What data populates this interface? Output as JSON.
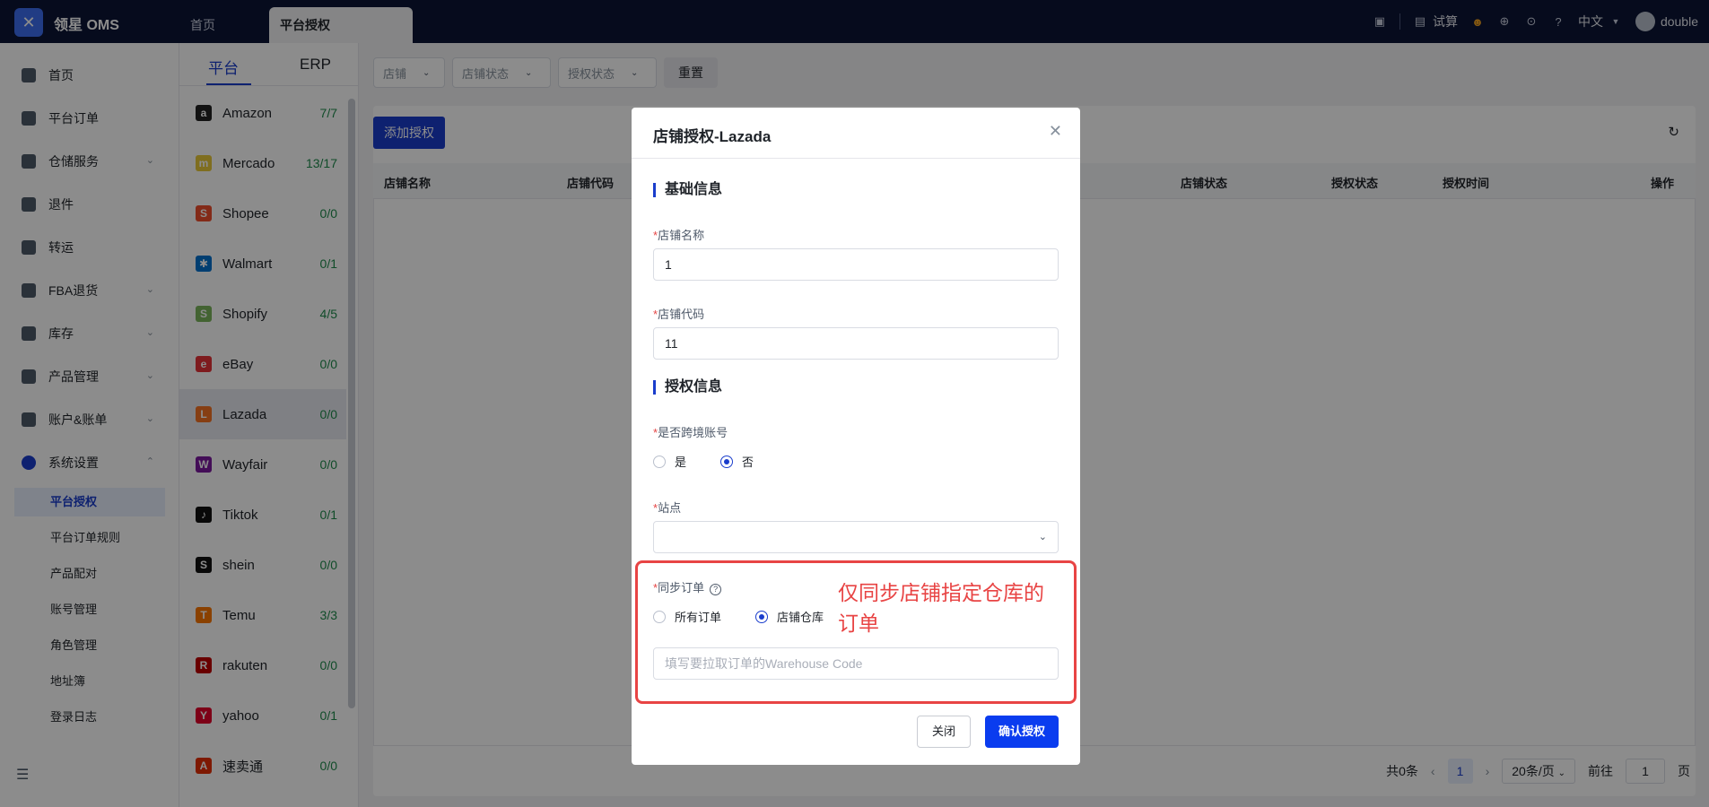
{
  "topbar": {
    "brand": "领星 OMS",
    "tabs": [
      {
        "label": "首页"
      },
      {
        "label": "平台授权"
      }
    ],
    "trial": "试算",
    "language": "中文",
    "user": "double"
  },
  "sidenav": {
    "items": [
      {
        "label": "首页",
        "icon": "home-icon"
      },
      {
        "label": "平台订单",
        "icon": "orders-icon"
      },
      {
        "label": "仓储服务",
        "icon": "warehouse-icon",
        "expandable": true
      },
      {
        "label": "退件",
        "icon": "return-icon"
      },
      {
        "label": "转运",
        "icon": "transfer-icon"
      },
      {
        "label": "FBA退货",
        "icon": "fba-icon",
        "expandable": true
      },
      {
        "label": "库存",
        "icon": "inventory-icon",
        "expandable": true
      },
      {
        "label": "产品管理",
        "icon": "product-icon",
        "expandable": true
      },
      {
        "label": "账户&账单",
        "icon": "account-icon",
        "expandable": true
      },
      {
        "label": "系统设置",
        "icon": "settings-icon",
        "expandable": true,
        "expanded": true
      }
    ],
    "subitems": [
      {
        "label": "平台授权",
        "active": true
      },
      {
        "label": "平台订单规则"
      },
      {
        "label": "产品配对"
      },
      {
        "label": "账号管理"
      },
      {
        "label": "角色管理"
      },
      {
        "label": "地址簿"
      },
      {
        "label": "登录日志"
      }
    ]
  },
  "platforms": {
    "tabs": [
      "平台",
      "ERP"
    ],
    "items": [
      {
        "name": "Amazon",
        "count": "7/7",
        "logo": "a",
        "color": "#222222"
      },
      {
        "name": "Mercado",
        "count": "13/17",
        "logo": "m",
        "color": "#e8c83a"
      },
      {
        "name": "Shopee",
        "count": "0/0",
        "logo": "S",
        "color": "#ee4d2d"
      },
      {
        "name": "Walmart",
        "count": "0/1",
        "logo": "✱",
        "color": "#0071ce"
      },
      {
        "name": "Shopify",
        "count": "4/5",
        "logo": "S",
        "color": "#7ab55c"
      },
      {
        "name": "eBay",
        "count": "0/0",
        "logo": "e",
        "color": "#e53238"
      },
      {
        "name": "Lazada",
        "count": "0/0",
        "logo": "L",
        "color": "#f57224",
        "active": true
      },
      {
        "name": "Wayfair",
        "count": "0/0",
        "logo": "W",
        "color": "#7b189f"
      },
      {
        "name": "Tiktok",
        "count": "0/1",
        "logo": "♪",
        "color": "#111111"
      },
      {
        "name": "shein",
        "count": "0/0",
        "logo": "S",
        "color": "#111111"
      },
      {
        "name": "Temu",
        "count": "3/3",
        "logo": "T",
        "color": "#fb7701"
      },
      {
        "name": "rakuten",
        "count": "0/0",
        "logo": "R",
        "color": "#bf0000"
      },
      {
        "name": "yahoo",
        "count": "0/1",
        "logo": "Y",
        "color": "#e4002b"
      },
      {
        "name": "速卖通",
        "count": "0/0",
        "logo": "A",
        "color": "#e62e04"
      }
    ]
  },
  "filters": {
    "store": "店铺",
    "store_status": "店铺状态",
    "auth_status": "授权状态",
    "reset": "重置"
  },
  "table": {
    "add_button": "添加授权",
    "columns": [
      "店铺名称",
      "店铺代码",
      "店铺状态",
      "授权状态",
      "授权时间",
      "操作"
    ]
  },
  "pager": {
    "total": "共0条",
    "current_page": "1",
    "page_size": "20条/页",
    "goto_label": "前往",
    "goto_value": "1",
    "page_unit": "页"
  },
  "modal": {
    "title": "店铺授权-Lazada",
    "section_basic": "基础信息",
    "store_name_label": "店铺名称",
    "store_name_value": "1",
    "store_code_label": "店铺代码",
    "store_code_value": "11",
    "section_auth": "授权信息",
    "cross_border_label": "是否跨境账号",
    "cross_border_yes": "是",
    "cross_border_no": "否",
    "site_label": "站点",
    "sync_label": "同步订单",
    "sync_all": "所有订单",
    "sync_store_warehouse": "店铺仓库",
    "warehouse_placeholder": "填写要拉取订单的Warehouse Code",
    "annotation": "仅同步店铺指定仓库的订单",
    "close_button": "关闭",
    "confirm_button": "确认授权"
  },
  "colors": {
    "primary": "#1a3dcc",
    "topbar": "#0b1536",
    "annotation": "#e84444"
  }
}
